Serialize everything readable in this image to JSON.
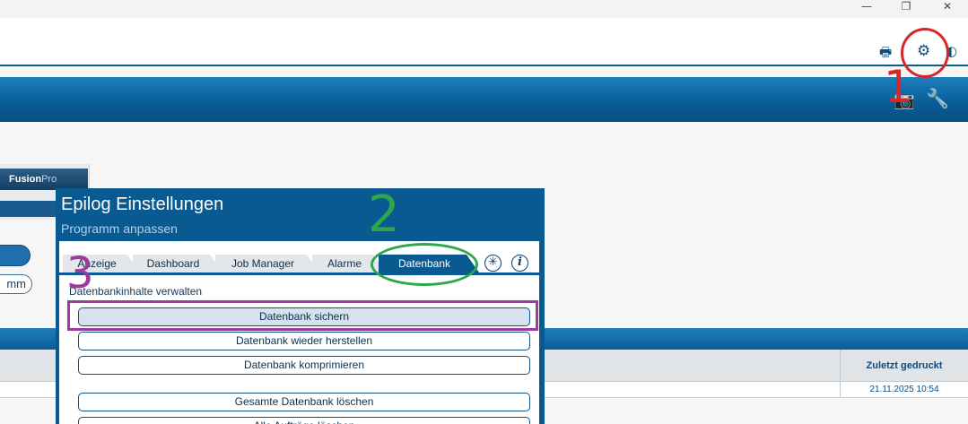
{
  "window": {
    "minimize_icon": "—",
    "restore_icon": "❐",
    "close_icon": "✕"
  },
  "header": {
    "print_icon": "🖶",
    "settings_icon": "⚙",
    "help_icon": "◐"
  },
  "toolbar": {
    "camera_icon": "📷",
    "wrench_icon": "🔧"
  },
  "background": {
    "brand_main": "Fusion",
    "brand_suffix": "Pro",
    "pill_text": "mm",
    "table_header": "Zuletzt gedruckt",
    "table_cell": "21.11.2025 10:54"
  },
  "dialog": {
    "title": "Epilog Einstellungen",
    "subtitle": "Programm anpassen",
    "tabs": [
      {
        "label": "Anzeige"
      },
      {
        "label": "Dashboard"
      },
      {
        "label": "Job Manager"
      },
      {
        "label": "Alarme"
      },
      {
        "label": "Datenbank",
        "active": true
      }
    ],
    "tab_icons": {
      "star": "✳",
      "info": "i"
    },
    "section_title": "Datenbankinhalte verwalten",
    "buttons": [
      {
        "label": "Datenbank sichern"
      },
      {
        "label": "Datenbank wieder herstellen"
      },
      {
        "label": "Datenbank komprimieren"
      },
      {
        "label": "Gesamte Datenbank löschen"
      },
      {
        "label": "Alle Aufträge löschen"
      }
    ]
  },
  "annotations": {
    "step1": "1",
    "step2": "2",
    "step3": "3",
    "colors": {
      "step1": "#d8262b",
      "step2": "#2aa84a",
      "step3": "#9b3c9c"
    }
  }
}
